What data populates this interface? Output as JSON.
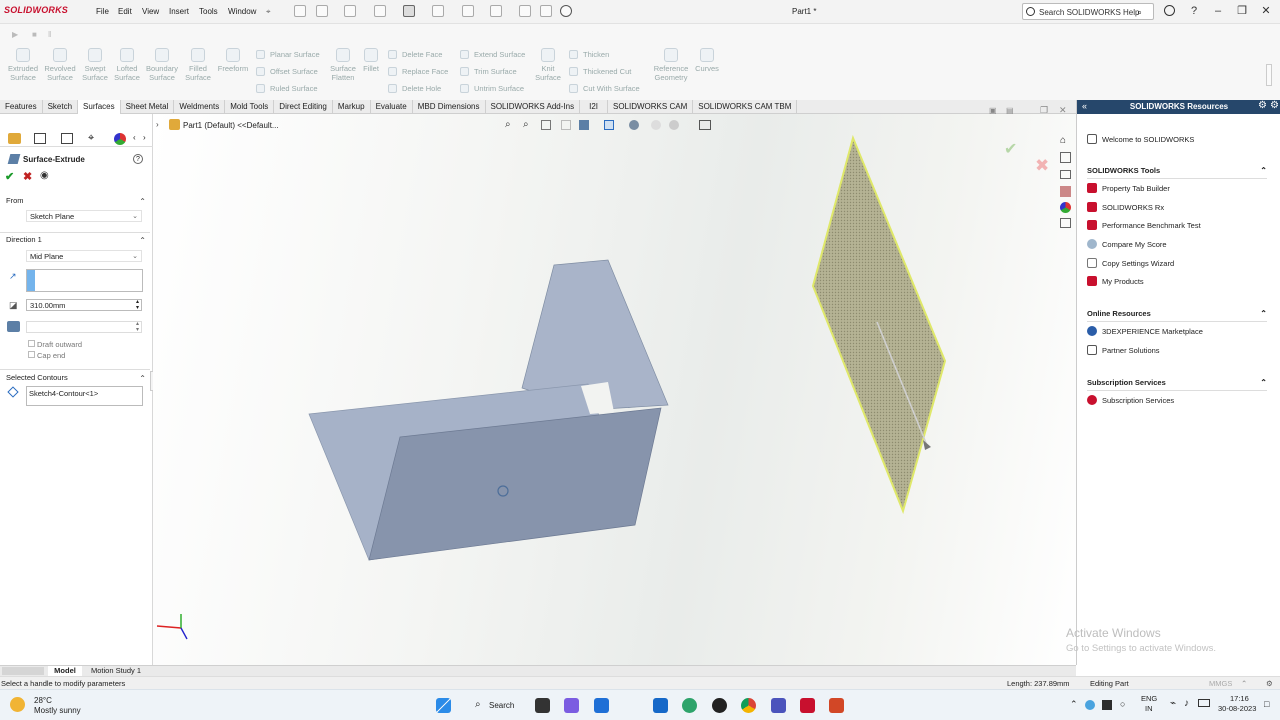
{
  "app": {
    "logo": "SOLIDWORKS",
    "doc_title": "Part1 *"
  },
  "menu": [
    "File",
    "Edit",
    "View",
    "Insert",
    "Tools",
    "Window"
  ],
  "search": {
    "placeholder": "Search SOLIDWORKS Help"
  },
  "ribbon": {
    "big": [
      {
        "l1": "Extruded",
        "l2": "Surface"
      },
      {
        "l1": "Revolved",
        "l2": "Surface"
      },
      {
        "l1": "Swept",
        "l2": "Surface"
      },
      {
        "l1": "Lofted",
        "l2": "Surface"
      },
      {
        "l1": "Boundary",
        "l2": "Surface"
      },
      {
        "l1": "Filled",
        "l2": "Surface"
      },
      {
        "l1": "Freeform",
        "l2": ""
      }
    ],
    "col1": [
      "Planar Surface",
      "Offset Surface",
      "Ruled Surface"
    ],
    "surface_flatten": {
      "l1": "Surface",
      "l2": "Flatten"
    },
    "fillet": "Fillet",
    "col2": [
      "Delete Face",
      "Replace Face",
      "Delete Hole"
    ],
    "col3": [
      "Extend Surface",
      "Trim Surface",
      "Untrim Surface"
    ],
    "knit": {
      "l1": "Knit",
      "l2": "Surface"
    },
    "col4": [
      "Thicken",
      "Thickened Cut",
      "Cut With Surface"
    ],
    "refgeo": {
      "l1": "Reference",
      "l2": "Geometry"
    },
    "curves": "Curves"
  },
  "tabs": [
    "Features",
    "Sketch",
    "Surfaces",
    "Sheet Metal",
    "Weldments",
    "Mold Tools",
    "Direct Editing",
    "Markup",
    "Evaluate",
    "MBD Dimensions",
    "SOLIDWORKS Add-Ins",
    "I2I",
    "SOLIDWORKS CAM",
    "SOLIDWORKS CAM TBM"
  ],
  "active_tab": "Surfaces",
  "feature": {
    "title": "Surface-Extrude",
    "from_label": "From",
    "from_value": "Sketch Plane",
    "dir_label": "Direction 1",
    "dir_value": "Mid Plane",
    "depth": "310.00mm",
    "draft_outward": "Draft outward",
    "cap_end": "Cap end",
    "contours_label": "Selected Contours",
    "contour_item": "Sketch4-Contour<1>"
  },
  "breadcrumb": "Part1 (Default) <<Default...",
  "resources": {
    "header": "SOLIDWORKS Resources",
    "welcome": "Welcome to SOLIDWORKS",
    "tools_label": "SOLIDWORKS Tools",
    "tools": [
      "Property Tab Builder",
      "SOLIDWORKS Rx",
      "Performance Benchmark Test",
      "Compare My Score",
      "Copy Settings Wizard",
      "My Products"
    ],
    "online_label": "Online Resources",
    "online": [
      "3DEXPERIENCE Marketplace",
      "Partner Solutions"
    ],
    "sub_label": "Subscription Services",
    "sub": [
      "Subscription Services"
    ]
  },
  "bottom_tabs": [
    "Model",
    "Motion Study 1"
  ],
  "status": {
    "message": "Select a handle to modify parameters",
    "length": "Length: 237.89mm",
    "mode": "Editing Part",
    "units": "MMGS"
  },
  "watermark": {
    "line1": "Activate Windows",
    "line2": "Go to Settings to activate Windows."
  },
  "taskbar": {
    "temp": "28°C",
    "weather": "Mostly sunny",
    "search": "Search",
    "lang1": "ENG",
    "lang2": "IN",
    "time": "17:16",
    "date": "30-08-2023"
  },
  "colors": {
    "header_blue": "#26476b",
    "model_blue": "#a6b2c8",
    "plane_fill": "#b9b79a",
    "plane_edge": "#dfe86a",
    "accent_red": "#c8102e"
  }
}
